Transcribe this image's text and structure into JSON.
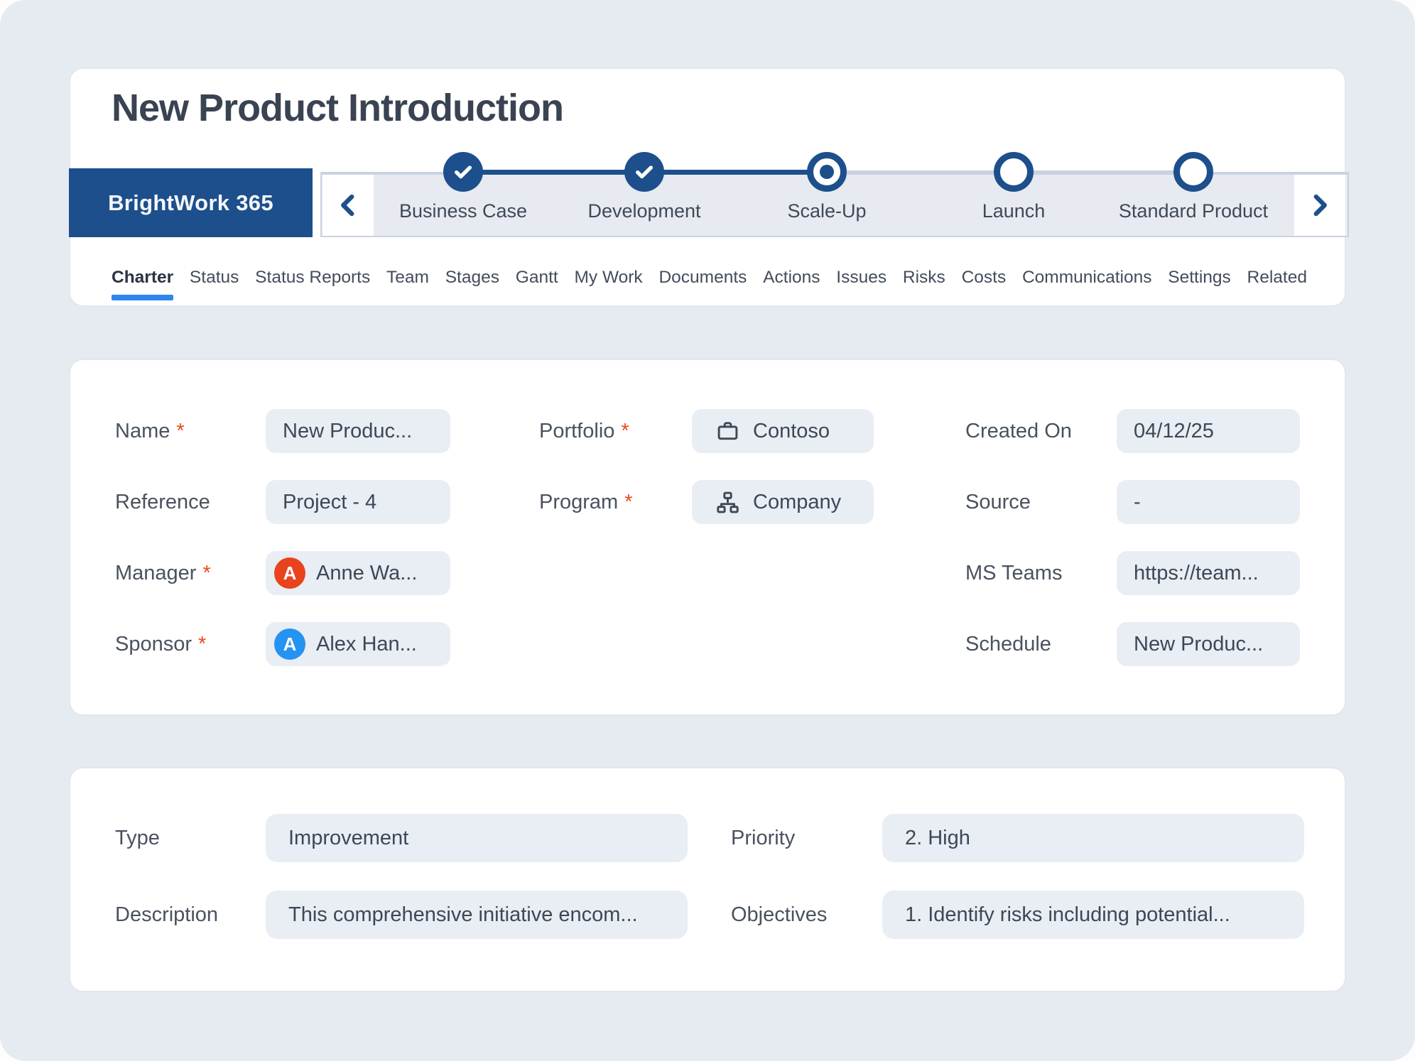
{
  "page": {
    "title": "New Product Introduction"
  },
  "stage_nav": {
    "brand": "BrightWork 365",
    "stages": [
      {
        "label": "Business Case",
        "state": "complete"
      },
      {
        "label": "Development",
        "state": "complete"
      },
      {
        "label": "Scale-Up",
        "state": "current"
      },
      {
        "label": "Launch",
        "state": "upcoming"
      },
      {
        "label": "Standard Product",
        "state": "upcoming"
      }
    ],
    "prev_icon": "chevron-left-icon",
    "next_icon": "chevron-right-icon"
  },
  "tabs": [
    {
      "label": "Charter",
      "active": true
    },
    {
      "label": "Status"
    },
    {
      "label": "Status Reports"
    },
    {
      "label": "Team"
    },
    {
      "label": "Stages"
    },
    {
      "label": "Gantt"
    },
    {
      "label": "My Work"
    },
    {
      "label": "Documents"
    },
    {
      "label": "Actions"
    },
    {
      "label": "Issues"
    },
    {
      "label": "Risks"
    },
    {
      "label": "Costs"
    },
    {
      "label": "Communications"
    },
    {
      "label": "Settings"
    },
    {
      "label": "Related"
    }
  ],
  "charter_card": {
    "col1": [
      {
        "label": "Name",
        "required": "*",
        "value": "New Produc..."
      },
      {
        "label": "Reference",
        "value": "Project - 4"
      },
      {
        "label": "Manager",
        "required": "*",
        "value": "Anne Wa...",
        "avatar_letter": "A",
        "avatar_color": "#e8431c"
      },
      {
        "label": "Sponsor",
        "required": "*",
        "value": "Alex Han...",
        "avatar_letter": "A",
        "avatar_color": "#2493f2"
      }
    ],
    "col2": [
      {
        "label": "Portfolio",
        "required": "*",
        "value": "Contoso",
        "icon": "briefcase-icon"
      },
      {
        "label": "Program",
        "required": "*",
        "value": "Company",
        "icon": "org-chart-icon"
      }
    ],
    "col3": [
      {
        "label": "Created On",
        "value": "04/12/25"
      },
      {
        "label": "Source",
        "value": "-"
      },
      {
        "label": "MS Teams",
        "value": "https://team..."
      },
      {
        "label": "Schedule",
        "value": "New Produc..."
      }
    ]
  },
  "details_card": {
    "left": [
      {
        "label": "Type",
        "value": "Improvement"
      },
      {
        "label": "Description",
        "value": "This comprehensive initiative encom..."
      }
    ],
    "right": [
      {
        "label": "Priority",
        "value": "2. High"
      },
      {
        "label": "Objectives",
        "value": "1. Identify risks including potential..."
      }
    ]
  },
  "colors": {
    "accent_blue": "#1d4f8c",
    "active_tab_underline": "#2e86ee",
    "page_background": "#e6eaf1",
    "field_background": "#e9edf4",
    "required_asterisk": "#e84b1d",
    "manager_avatar": "#e8431c",
    "sponsor_avatar": "#2493f2",
    "title_text": "#3a4352",
    "stage_connector_done": "#1d4f8c",
    "stage_connector_todo": "#c9d3e0"
  }
}
